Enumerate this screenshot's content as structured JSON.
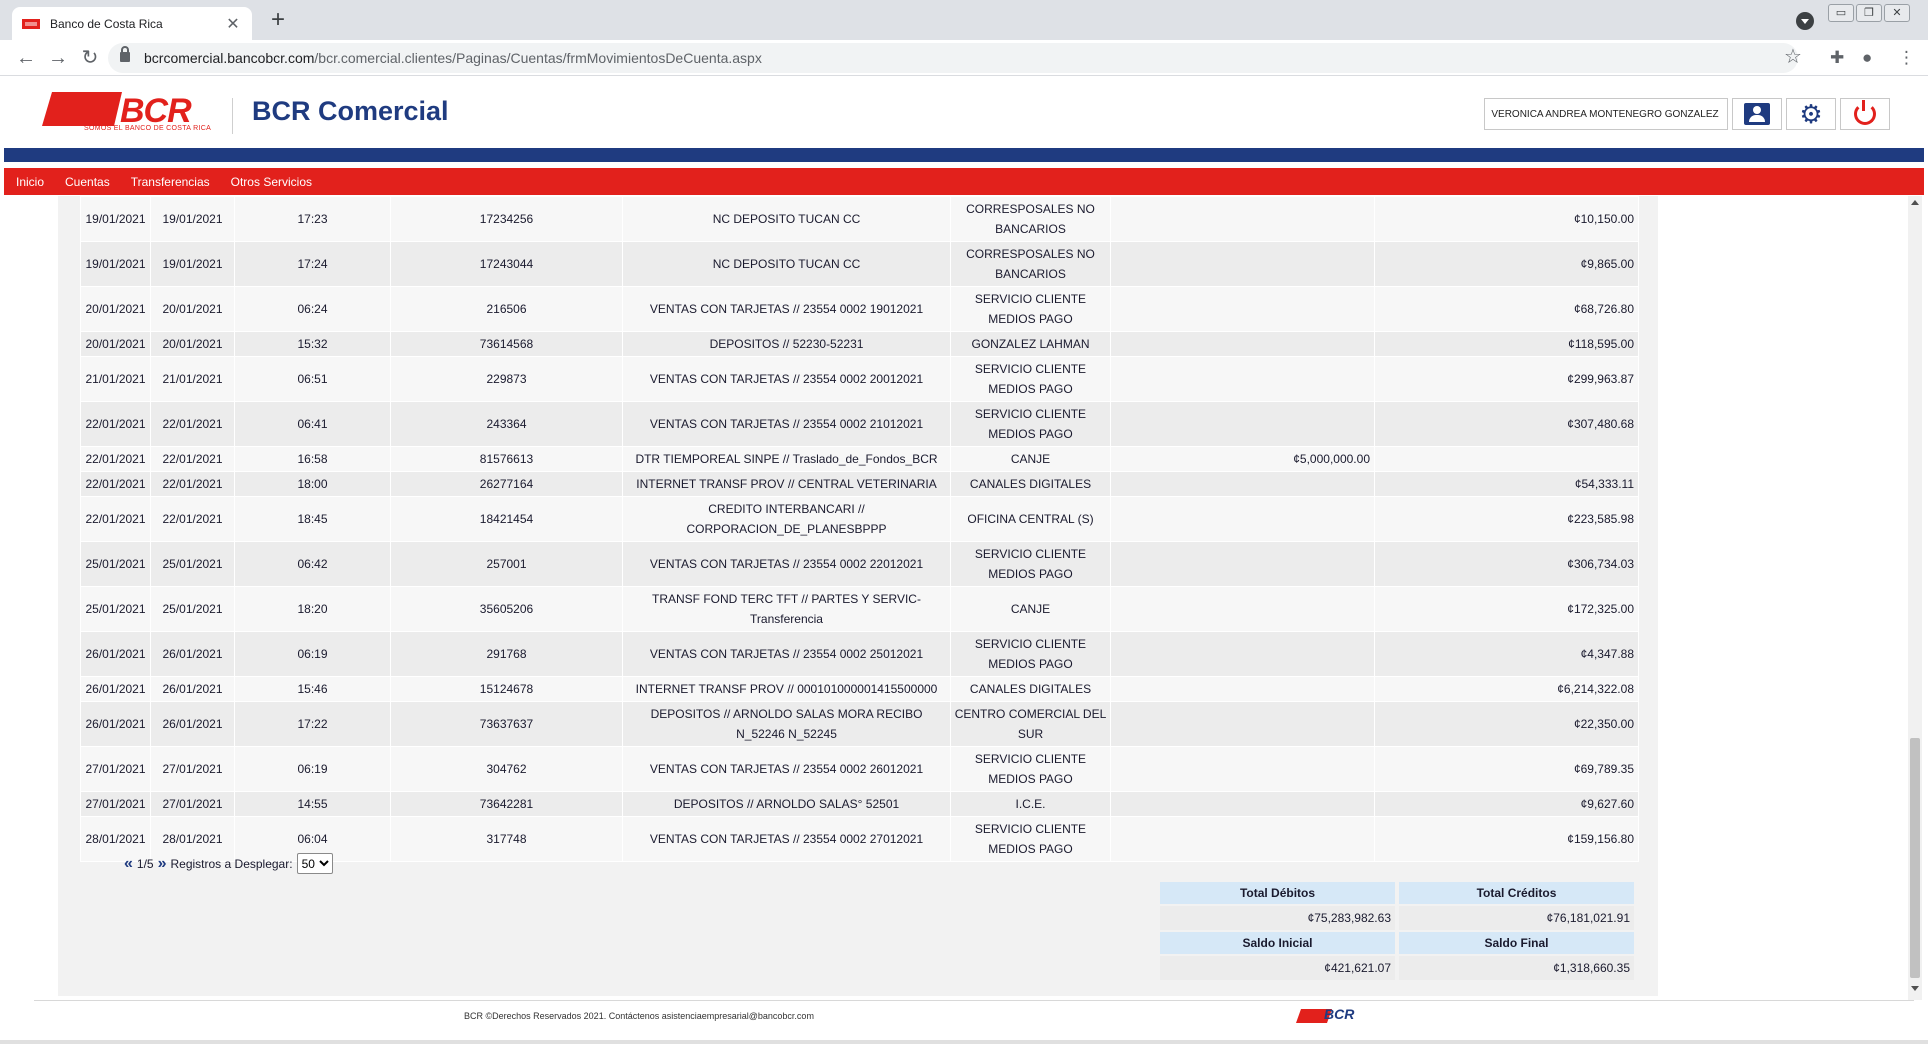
{
  "browser": {
    "tab_title": "Banco de Costa Rica",
    "tab_close": "✕",
    "new_tab": "+",
    "url_host": "bcrcomercial.bancobcr.com",
    "url_path": "/bcr.comercial.clientes/Paginas/Cuentas/frmMovimientosDeCuenta.aspx",
    "win_minimize": "▭",
    "win_restore": "❐",
    "win_close": "✕"
  },
  "header": {
    "logo_text": "BCR",
    "logo_tagline": "SOMOS EL BANCO DE COSTA RICA",
    "brand_name": "BCR Comercial",
    "user_name": "VERONICA ANDREA MONTENEGRO GONZALEZ",
    "colors": {
      "brand_red": "#e2211c",
      "brand_blue": "#1f3b80"
    }
  },
  "nav": {
    "items": [
      {
        "label": "Inicio"
      },
      {
        "label": "Cuentas"
      },
      {
        "label": "Transferencias"
      },
      {
        "label": "Otros Servicios"
      }
    ]
  },
  "transactions": [
    {
      "date": "19/01/2021",
      "value_date": "19/01/2021",
      "time": "17:23",
      "doc": "17234256",
      "description": "NC DEPOSITO TUCAN CC",
      "office": "CORRESPOSALES NO BANCARIOS",
      "debit": "",
      "credit": "¢10,150.00"
    },
    {
      "date": "19/01/2021",
      "value_date": "19/01/2021",
      "time": "17:24",
      "doc": "17243044",
      "description": "NC DEPOSITO TUCAN CC",
      "office": "CORRESPOSALES NO BANCARIOS",
      "debit": "",
      "credit": "¢9,865.00"
    },
    {
      "date": "20/01/2021",
      "value_date": "20/01/2021",
      "time": "06:24",
      "doc": "216506",
      "description": "VENTAS CON TARJETAS // 23554 0002 19012021",
      "office": "SERVICIO CLIENTE MEDIOS PAGO",
      "debit": "",
      "credit": "¢68,726.80"
    },
    {
      "date": "20/01/2021",
      "value_date": "20/01/2021",
      "time": "15:32",
      "doc": "73614568",
      "description": "DEPOSITOS // 52230-52231",
      "office": "GONZALEZ LAHMAN",
      "debit": "",
      "credit": "¢118,595.00"
    },
    {
      "date": "21/01/2021",
      "value_date": "21/01/2021",
      "time": "06:51",
      "doc": "229873",
      "description": "VENTAS CON TARJETAS // 23554 0002 20012021",
      "office": "SERVICIO CLIENTE MEDIOS PAGO",
      "debit": "",
      "credit": "¢299,963.87"
    },
    {
      "date": "22/01/2021",
      "value_date": "22/01/2021",
      "time": "06:41",
      "doc": "243364",
      "description": "VENTAS CON TARJETAS // 23554 0002 21012021",
      "office": "SERVICIO CLIENTE MEDIOS PAGO",
      "debit": "",
      "credit": "¢307,480.68"
    },
    {
      "date": "22/01/2021",
      "value_date": "22/01/2021",
      "time": "16:58",
      "doc": "81576613",
      "description": "DTR TIEMPOREAL SINPE // Traslado_de_Fondos_BCR",
      "office": "CANJE",
      "debit": "¢5,000,000.00",
      "credit": ""
    },
    {
      "date": "22/01/2021",
      "value_date": "22/01/2021",
      "time": "18:00",
      "doc": "26277164",
      "description": "INTERNET TRANSF PROV // CENTRAL VETERINARIA",
      "office": "CANALES DIGITALES",
      "debit": "",
      "credit": "¢54,333.11"
    },
    {
      "date": "22/01/2021",
      "value_date": "22/01/2021",
      "time": "18:45",
      "doc": "18421454",
      "description": "CREDITO INTERBANCARI // CORPORACION_DE_PLANESBPPP",
      "office": "OFICINA CENTRAL (S)",
      "debit": "",
      "credit": "¢223,585.98"
    },
    {
      "date": "25/01/2021",
      "value_date": "25/01/2021",
      "time": "06:42",
      "doc": "257001",
      "description": "VENTAS CON TARJETAS // 23554 0002 22012021",
      "office": "SERVICIO CLIENTE MEDIOS PAGO",
      "debit": "",
      "credit": "¢306,734.03"
    },
    {
      "date": "25/01/2021",
      "value_date": "25/01/2021",
      "time": "18:20",
      "doc": "35605206",
      "description": "TRANSF FOND TERC TFT // PARTES Y SERVIC-Transferencia",
      "office": "CANJE",
      "debit": "",
      "credit": "¢172,325.00"
    },
    {
      "date": "26/01/2021",
      "value_date": "26/01/2021",
      "time": "06:19",
      "doc": "291768",
      "description": "VENTAS CON TARJETAS // 23554 0002 25012021",
      "office": "SERVICIO CLIENTE MEDIOS PAGO",
      "debit": "",
      "credit": "¢4,347.88"
    },
    {
      "date": "26/01/2021",
      "value_date": "26/01/2021",
      "time": "15:46",
      "doc": "15124678",
      "description": "INTERNET TRANSF PROV // 000101000001415500000",
      "office": "CANALES DIGITALES",
      "debit": "",
      "credit": "¢6,214,322.08"
    },
    {
      "date": "26/01/2021",
      "value_date": "26/01/2021",
      "time": "17:22",
      "doc": "73637637",
      "description": "DEPOSITOS // ARNOLDO SALAS MORA RECIBO N_52246 N_52245",
      "office": "CENTRO COMERCIAL DEL SUR",
      "debit": "",
      "credit": "¢22,350.00"
    },
    {
      "date": "27/01/2021",
      "value_date": "27/01/2021",
      "time": "06:19",
      "doc": "304762",
      "description": "VENTAS CON TARJETAS // 23554 0002 26012021",
      "office": "SERVICIO CLIENTE MEDIOS PAGO",
      "debit": "",
      "credit": "¢69,789.35"
    },
    {
      "date": "27/01/2021",
      "value_date": "27/01/2021",
      "time": "14:55",
      "doc": "73642281",
      "description": "DEPOSITOS // ARNOLDO SALAS° 52501",
      "office": "I.C.E.",
      "debit": "",
      "credit": "¢9,627.60"
    },
    {
      "date": "28/01/2021",
      "value_date": "28/01/2021",
      "time": "06:04",
      "doc": "317748",
      "description": "VENTAS CON TARJETAS // 23554 0002 27012021",
      "office": "SERVICIO CLIENTE MEDIOS PAGO",
      "debit": "",
      "credit": "¢159,156.80"
    }
  ],
  "pager": {
    "prev": "«",
    "page": "1/5",
    "next": "»",
    "label": "Registros a Desplegar:",
    "page_size": "50"
  },
  "totals": {
    "total_debits_label": "Total Débitos",
    "total_credits_label": "Total Créditos",
    "total_debits": "¢75,283,982.63",
    "total_credits": "¢76,181,021.91",
    "initial_balance_label": "Saldo Inicial",
    "final_balance_label": "Saldo Final",
    "initial_balance": "¢421,621.07",
    "final_balance": "¢1,318,660.35"
  },
  "footer": {
    "copyright": "BCR ©Derechos Reservados 2021. Contáctenos asistenciaempresarial@bancobcr.com",
    "logo_text": "BCR"
  }
}
